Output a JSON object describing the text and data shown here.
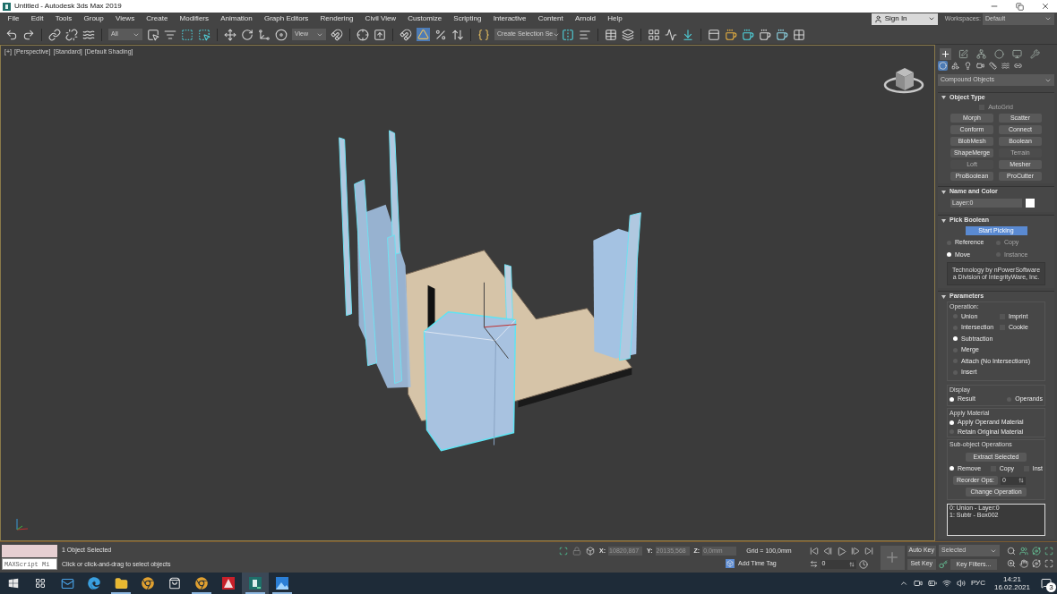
{
  "window": {
    "title": "Untitled - Autodesk 3ds Max 2019"
  },
  "menu": [
    "File",
    "Edit",
    "Tools",
    "Group",
    "Views",
    "Create",
    "Modifiers",
    "Animation",
    "Graph Editors",
    "Rendering",
    "Civil View",
    "Customize",
    "Scripting",
    "Interactive",
    "Content",
    "Arnold",
    "Help"
  ],
  "account": {
    "sign_in": "Sign In",
    "workspaces_label": "Workspaces:",
    "workspace": "Default"
  },
  "toolbar": {
    "selection_filter": "All",
    "reference_coordinate": "View",
    "named_selection": "Create Selection Se",
    "angle_snap_on": true
  },
  "viewport": {
    "labels": [
      "[+]",
      "[Perspective]",
      "[Standard]",
      "[Default Shading]"
    ]
  },
  "command_panel": {
    "tabs": [
      {
        "selected": true
      },
      {
        "selected": false
      },
      {
        "selected": false
      },
      {
        "selected": false
      },
      {
        "selected": false
      },
      {
        "selected": false
      }
    ],
    "categories": [
      {
        "selected": true
      },
      {
        "selected": false
      },
      {
        "selected": false
      },
      {
        "selected": false
      },
      {
        "selected": false
      },
      {
        "selected": false
      },
      {
        "selected": false
      }
    ],
    "category": "Compound Objects",
    "object_type": {
      "title": "Object Type",
      "autogrid": {
        "label": "AutoGrid",
        "checked": false,
        "disabled": true
      },
      "buttons": [
        {
          "label": "Morph",
          "disabled": false
        },
        {
          "label": "Scatter",
          "disabled": false
        },
        {
          "label": "Conform",
          "disabled": false
        },
        {
          "label": "Connect",
          "disabled": false
        },
        {
          "label": "BlobMesh",
          "disabled": false
        },
        {
          "label": "Boolean",
          "disabled": false
        },
        {
          "label": "ShapeMerge",
          "disabled": false
        },
        {
          "label": "Terrain",
          "disabled": true
        },
        {
          "label": "Loft",
          "disabled": true
        },
        {
          "label": "Mesher",
          "disabled": false
        },
        {
          "label": "ProBoolean",
          "disabled": false
        },
        {
          "label": "ProCutter",
          "disabled": false
        }
      ]
    },
    "name_and_color": {
      "title": "Name and Color",
      "name": "Layer:0",
      "color": "#ffffff"
    },
    "pick_boolean": {
      "title": "Pick Boolean",
      "button": "Start Picking",
      "options": [
        {
          "label": "Reference",
          "selected": false,
          "disabled": false
        },
        {
          "label": "Copy",
          "selected": false,
          "disabled": true
        },
        {
          "label": "Move",
          "selected": true,
          "disabled": false
        },
        {
          "label": "Instance",
          "selected": false,
          "disabled": true
        }
      ],
      "note": "Technology by nPowerSoftware a Division of IntegrityWare, Inc."
    },
    "parameters": {
      "title": "Parameters",
      "operation_label": "Operation:",
      "operations": [
        {
          "label": "Union",
          "selected": false
        },
        {
          "label": "Intersection",
          "selected": false
        },
        {
          "label": "Subtraction",
          "selected": true
        },
        {
          "label": "Merge",
          "selected": false
        },
        {
          "label": "Attach (No Intersections)",
          "selected": false
        },
        {
          "label": "Insert",
          "selected": false
        }
      ],
      "operation_flags": [
        {
          "label": "Imprint",
          "checked": false
        },
        {
          "label": "Cookie",
          "checked": false
        }
      ],
      "display_label": "Display",
      "display": [
        {
          "label": "Result",
          "selected": true
        },
        {
          "label": "Operands",
          "selected": false
        }
      ],
      "material_label": "Apply Material",
      "material": [
        {
          "label": "Apply Operand Material",
          "selected": true
        },
        {
          "label": "Retain Original Material",
          "selected": false
        }
      ],
      "sub_object_label": "Sub-object Operations",
      "extract_button": "Extract Selected",
      "extract_options": [
        {
          "kind": "radio",
          "label": "Remove",
          "on": true
        },
        {
          "kind": "check",
          "label": "Copy",
          "on": false
        },
        {
          "kind": "check",
          "label": "Inst",
          "on": false
        }
      ],
      "reorder_button": "Reorder Ops:",
      "reorder_value": "0",
      "change_button": "Change Operation",
      "operands": [
        "0: Union - Layer:0",
        "1: Subtr - Box002"
      ]
    }
  },
  "status_bar": {
    "maxscript": "MAXScript Mi",
    "selection": "1 Object Selected",
    "prompt": "Click or click-and-drag to select objects",
    "coords": [
      {
        "label": "X:",
        "value": "10820,867"
      },
      {
        "label": "Y:",
        "value": "20135,568"
      },
      {
        "label": "Z:",
        "value": "0,0mm"
      }
    ],
    "grid": "Grid = 100,0mm",
    "time_tag": "Add Time Tag",
    "frame": "0",
    "auto_key": "Auto Key",
    "set_key": "Set Key",
    "key_mode": "Selected",
    "key_filters": "Key Filters..."
  },
  "taskbar": {
    "apps": [
      {
        "kind": "mail",
        "running": false,
        "selected": false
      },
      {
        "kind": "edge",
        "running": false,
        "selected": false
      },
      {
        "kind": "folder",
        "running": true,
        "selected": false
      },
      {
        "kind": "chrome",
        "running": false,
        "selected": false
      },
      {
        "kind": "store",
        "running": false,
        "selected": false
      },
      {
        "kind": "chrome",
        "running": true,
        "selected": false
      },
      {
        "kind": "autocad",
        "running": false,
        "selected": false
      },
      {
        "kind": "max",
        "running": true,
        "selected": true
      },
      {
        "kind": "photos",
        "running": true,
        "selected": false
      }
    ],
    "language": "РУС",
    "time": "14:21",
    "date": "16.02.2021",
    "notifications": "3"
  }
}
